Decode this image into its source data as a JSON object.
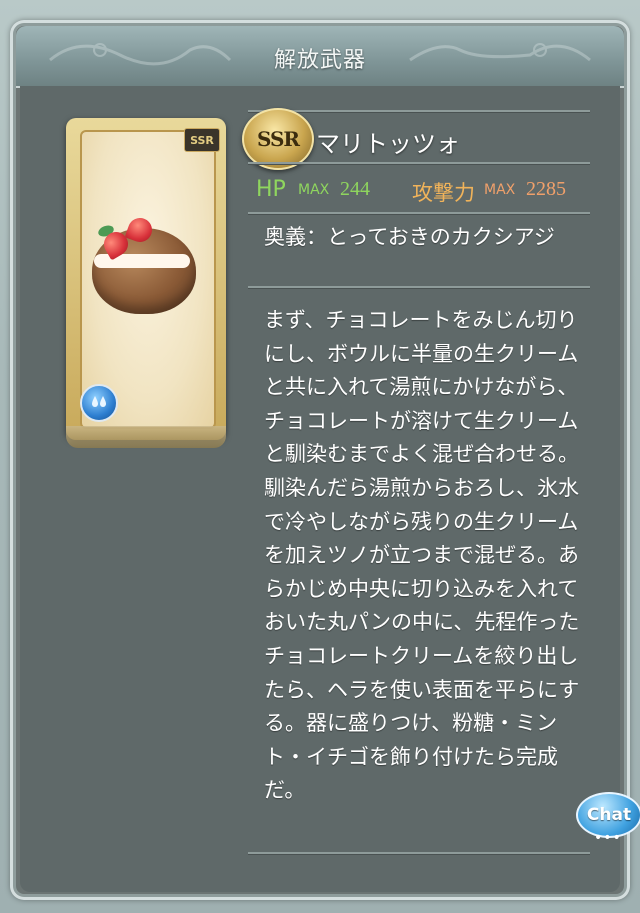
{
  "header": {
    "title": "解放武器"
  },
  "weapon": {
    "rarity": "SSR",
    "card_rarity": "SSR",
    "name": "マリトッツォ",
    "element_icon": "water-element-icon",
    "stats": {
      "hp_label": "HP",
      "hp_max_label": "MAX",
      "hp_value": "244",
      "atk_label": "攻撃力",
      "atk_max_label": "MAX",
      "atk_value": "2285"
    },
    "ougi": "奥義：とっておきのカクシアジ",
    "description": "まず、チョコレートをみじん切りにし、ボウルに半量の生クリームと共に入れて湯煎にかけながら、チョコレートが溶けて生クリームと馴染むまでよく混ぜ合わせる。馴染んだら湯煎からおろし、氷水で冷やしながら残りの生クリームを加えツノが立つまで混ぜる。あらかじめ中央に切り込みを入れておいた丸パンの中に、先程作ったチョコレートクリームを絞り出したら、ヘラを使い表面を平らにする。器に盛りつけ、粉糖・ミント・イチゴを飾り付けたら完成だ。"
  },
  "chat": {
    "label": "Chat",
    "dots": "•••"
  }
}
